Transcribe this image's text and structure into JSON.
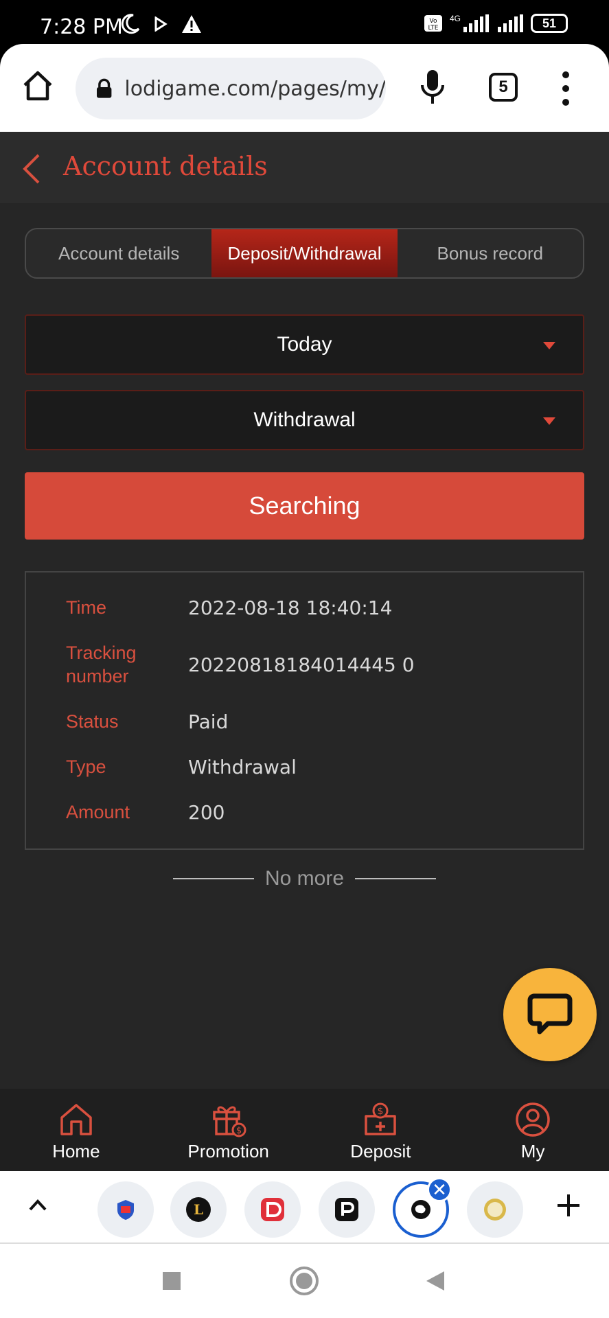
{
  "status_bar": {
    "time": "7:28 PM",
    "network": "4G",
    "volte": "Vo LTE",
    "battery": "51"
  },
  "browser": {
    "url": "lodigame.com/pages/my/",
    "tab_count": "5"
  },
  "header": {
    "title": "Account details"
  },
  "tabs": [
    {
      "label": "Account details",
      "active": false
    },
    {
      "label": "Deposit/Withdrawal",
      "active": true
    },
    {
      "label": "Bonus record",
      "active": false
    }
  ],
  "filters": {
    "period": "Today",
    "type": "Withdrawal"
  },
  "search_button": "Searching",
  "record": {
    "time_label": "Time",
    "time_value": "2022-08-18 18:40:14",
    "tracking_label": "Tracking number",
    "tracking_value": "20220818184014445 0",
    "status_label": "Status",
    "status_value": "Paid",
    "type_label": "Type",
    "type_value": "Withdrawal",
    "amount_label": "Amount",
    "amount_value": "200"
  },
  "list_end": "No more",
  "bottom_nav": [
    {
      "label": "Home",
      "icon": "home-icon"
    },
    {
      "label": "Promotion",
      "icon": "gift-icon"
    },
    {
      "label": "Deposit",
      "icon": "deposit-icon"
    },
    {
      "label": "My",
      "icon": "user-icon"
    }
  ],
  "colors": {
    "accent": "#d64a3a",
    "title_red": "#e0493a",
    "tab_active": "#b52619",
    "background": "#262626",
    "fab": "#f8b43c"
  }
}
